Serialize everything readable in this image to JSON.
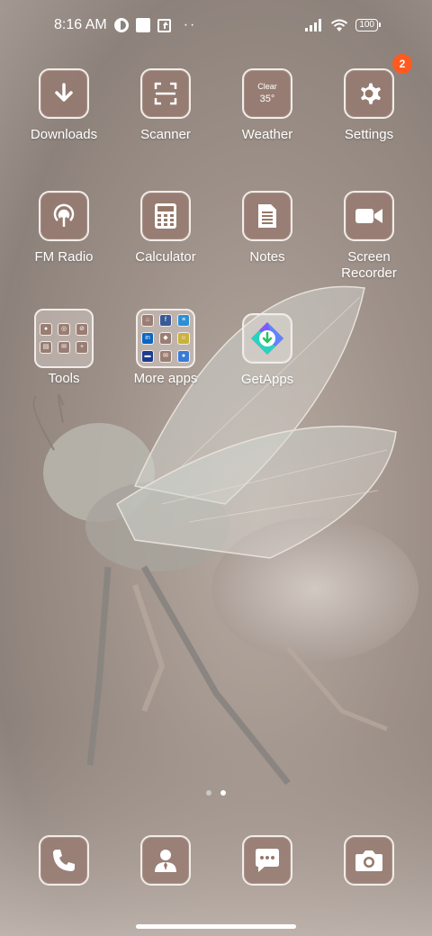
{
  "status_bar": {
    "time": "8:16 AM",
    "left_icons": [
      "dnd-icon",
      "square-icon",
      "upload-icon",
      "more-dots-icon"
    ],
    "more_dots": "··",
    "right_icons": [
      "signal-icon",
      "wifi-icon",
      "battery-icon"
    ],
    "battery": "100"
  },
  "apps": [
    {
      "label": "Downloads",
      "icon": "download-icon"
    },
    {
      "label": "Scanner",
      "icon": "scanner-icon"
    },
    {
      "label": "Weather",
      "icon": "weather-icon",
      "condition": "Clear",
      "temp": "35°"
    },
    {
      "label": "Settings",
      "icon": "gear-icon",
      "badge": "2"
    },
    {
      "label": "FM Radio",
      "icon": "radio-icon"
    },
    {
      "label": "Calculator",
      "icon": "calculator-icon"
    },
    {
      "label": "Notes",
      "icon": "notes-icon"
    },
    {
      "label": "Screen Recorder",
      "label_line1": "Screen",
      "label_line2": "Recorder",
      "icon": "video-camera-icon"
    },
    {
      "label": "Tools",
      "icon": "folder-icon"
    },
    {
      "label": "More apps",
      "icon": "folder-icon"
    },
    {
      "label": "GetApps",
      "icon": "getapps-icon"
    }
  ],
  "dock": [
    {
      "name": "phone",
      "icon": "phone-icon"
    },
    {
      "name": "contacts",
      "icon": "contacts-icon"
    },
    {
      "name": "messages",
      "icon": "messages-icon"
    },
    {
      "name": "camera",
      "icon": "camera-icon"
    }
  ],
  "page_indicator": {
    "pages": 2,
    "current": 2
  },
  "colors": {
    "badge": "#ff5a1f",
    "tile": "#967868",
    "tile_border": "#f2ece8"
  }
}
